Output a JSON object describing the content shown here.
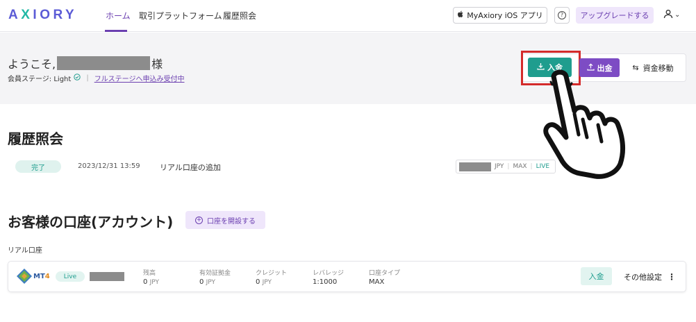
{
  "header": {
    "logo": {
      "before": "A",
      "x": "X",
      "after": "IORY"
    },
    "nav": [
      "ホーム",
      "取引プラットフォーム",
      "履歴照会"
    ],
    "ios_button": "MyAxiory iOS アプリ",
    "help": "?",
    "upgrade_button": "アップグレードする",
    "user_menu_chevron": "⌄"
  },
  "welcome": {
    "greeting": "ようこそ,",
    "suffix": "様",
    "stage_label": "会員ステージ: Light",
    "stage_separator": "|",
    "full_stage_link": "フルステージへ申込み受付中"
  },
  "actions": {
    "deposit": "入金",
    "withdraw": "出金",
    "transfer": "資金移動",
    "transfer_icon": "⇆"
  },
  "history": {
    "title": "履歴照会",
    "items": [
      {
        "status": "完了",
        "datetime": "2023/12/31 13:59",
        "description": "リアル口座の追加",
        "currency": "JPY",
        "leverage": "MAX",
        "type": "LIVE"
      }
    ]
  },
  "accounts": {
    "title": "お客様の口座(アカウント)",
    "open_button": "口座を開設する",
    "real_label": "リアル口座",
    "cards": [
      {
        "platform_a": "MT",
        "platform_b": "4",
        "status": "Live",
        "balance_label": "残高",
        "balance_value": "0",
        "balance_unit": "JPY",
        "margin_label": "有効証拠金",
        "margin_value": "0",
        "margin_unit": "JPY",
        "credit_label": "クレジット",
        "credit_value": "0",
        "credit_unit": "JPY",
        "leverage_label": "レバレッジ",
        "leverage_value": "1:1000",
        "account_type_label": "口座タイプ",
        "account_type_value": "MAX",
        "deposit_button": "入金",
        "other_settings": "その他設定",
        "more_icon": "⋮"
      }
    ]
  },
  "colors": {
    "brand_purple": "#6b3fb0",
    "teal": "#1f9d8e",
    "highlight_red": "#d42b2b"
  },
  "icons": [
    "apple-icon",
    "help-icon",
    "user-icon",
    "check-circle-icon",
    "download-icon",
    "upload-icon",
    "transfer-icon",
    "plus-circle-icon",
    "mt4-icon",
    "more-icon",
    "pointing-hand-icon"
  ]
}
